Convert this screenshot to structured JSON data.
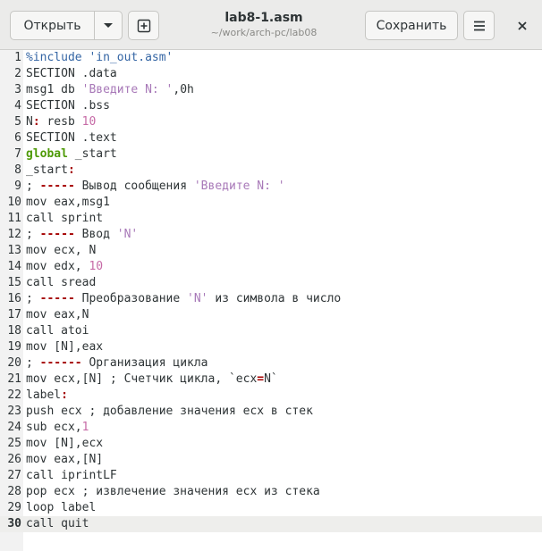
{
  "header": {
    "open_label": "Открыть",
    "save_label": "Сохранить",
    "title": "lab8-1.asm",
    "subtitle": "~/work/arch-pc/lab08"
  },
  "icons": {
    "open_menu": "chevron-down-icon",
    "new_tab": "new-tab-icon",
    "menu": "hamburger-menu-icon",
    "close": "close-icon"
  },
  "colors": {
    "keyword": "#4e9a06",
    "string": "#a879b8",
    "number": "#c66aa6",
    "preprocessor": "#3465a4"
  },
  "editor": {
    "current_line": 30,
    "lines": [
      {
        "n": "1",
        "segs": [
          {
            "t": "%include ",
            "c": "pre"
          },
          {
            "t": "'in_out.asm'",
            "c": "pre"
          }
        ]
      },
      {
        "n": "2",
        "segs": [
          {
            "t": "SECTION .data",
            "c": ""
          }
        ]
      },
      {
        "n": "3",
        "segs": [
          {
            "t": "msg1 db ",
            "c": ""
          },
          {
            "t": "'Введите N: '",
            "c": "str"
          },
          {
            "t": ",0h",
            "c": ""
          }
        ]
      },
      {
        "n": "4",
        "segs": [
          {
            "t": "SECTION .bss",
            "c": ""
          }
        ]
      },
      {
        "n": "5",
        "segs": [
          {
            "t": "N",
            "c": ""
          },
          {
            "t": ":",
            "c": "op"
          },
          {
            "t": " resb ",
            "c": ""
          },
          {
            "t": "10",
            "c": "num"
          }
        ]
      },
      {
        "n": "6",
        "segs": [
          {
            "t": "SECTION .text",
            "c": ""
          }
        ]
      },
      {
        "n": "7",
        "segs": [
          {
            "t": "global",
            "c": "kw"
          },
          {
            "t": " _start",
            "c": ""
          }
        ]
      },
      {
        "n": "8",
        "segs": [
          {
            "t": "_start",
            "c": ""
          },
          {
            "t": ":",
            "c": "op"
          }
        ]
      },
      {
        "n": "9",
        "segs": [
          {
            "t": "; ",
            "c": ""
          },
          {
            "t": "-----",
            "c": "op"
          },
          {
            "t": " Вывод сообщения ",
            "c": ""
          },
          {
            "t": "'Введите N: '",
            "c": "str"
          }
        ]
      },
      {
        "n": "10",
        "segs": [
          {
            "t": "mov eax,msg1",
            "c": ""
          }
        ]
      },
      {
        "n": "11",
        "segs": [
          {
            "t": "call sprint",
            "c": ""
          }
        ]
      },
      {
        "n": "12",
        "segs": [
          {
            "t": "; ",
            "c": ""
          },
          {
            "t": "-----",
            "c": "op"
          },
          {
            "t": " Ввод ",
            "c": ""
          },
          {
            "t": "'N'",
            "c": "str"
          }
        ]
      },
      {
        "n": "13",
        "segs": [
          {
            "t": "mov ecx, N",
            "c": ""
          }
        ]
      },
      {
        "n": "14",
        "segs": [
          {
            "t": "mov edx, ",
            "c": ""
          },
          {
            "t": "10",
            "c": "num"
          }
        ]
      },
      {
        "n": "15",
        "segs": [
          {
            "t": "call sread",
            "c": ""
          }
        ]
      },
      {
        "n": "16",
        "segs": [
          {
            "t": "; ",
            "c": ""
          },
          {
            "t": "-----",
            "c": "op"
          },
          {
            "t": " Преобразование ",
            "c": ""
          },
          {
            "t": "'N'",
            "c": "str"
          },
          {
            "t": " из символа в число",
            "c": ""
          }
        ]
      },
      {
        "n": "17",
        "segs": [
          {
            "t": "mov eax,N",
            "c": ""
          }
        ]
      },
      {
        "n": "18",
        "segs": [
          {
            "t": "call atoi",
            "c": ""
          }
        ]
      },
      {
        "n": "19",
        "segs": [
          {
            "t": "mov [N],eax",
            "c": ""
          }
        ]
      },
      {
        "n": "20",
        "segs": [
          {
            "t": "; ",
            "c": ""
          },
          {
            "t": "------",
            "c": "op"
          },
          {
            "t": " Организация цикла",
            "c": ""
          }
        ]
      },
      {
        "n": "21",
        "segs": [
          {
            "t": "mov ecx,[N] ; Счетчик цикла, `ecx",
            "c": ""
          },
          {
            "t": "=",
            "c": "op"
          },
          {
            "t": "N`",
            "c": ""
          }
        ]
      },
      {
        "n": "22",
        "segs": [
          {
            "t": "label",
            "c": ""
          },
          {
            "t": ":",
            "c": "op"
          }
        ]
      },
      {
        "n": "23",
        "segs": [
          {
            "t": "push ecx ; добавление значения ecx в стек",
            "c": ""
          }
        ]
      },
      {
        "n": "24",
        "segs": [
          {
            "t": "sub ecx,",
            "c": ""
          },
          {
            "t": "1",
            "c": "num"
          }
        ]
      },
      {
        "n": "25",
        "segs": [
          {
            "t": "mov [N],ecx",
            "c": ""
          }
        ]
      },
      {
        "n": "26",
        "segs": [
          {
            "t": "mov eax,[N]",
            "c": ""
          }
        ]
      },
      {
        "n": "27",
        "segs": [
          {
            "t": "call iprintLF",
            "c": ""
          }
        ]
      },
      {
        "n": "28",
        "segs": [
          {
            "t": "pop ecx ; извлечение значения ecx из стека",
            "c": ""
          }
        ]
      },
      {
        "n": "29",
        "segs": [
          {
            "t": "loop label",
            "c": ""
          }
        ]
      },
      {
        "n": "30",
        "segs": [
          {
            "t": "call quit",
            "c": ""
          }
        ]
      }
    ]
  }
}
